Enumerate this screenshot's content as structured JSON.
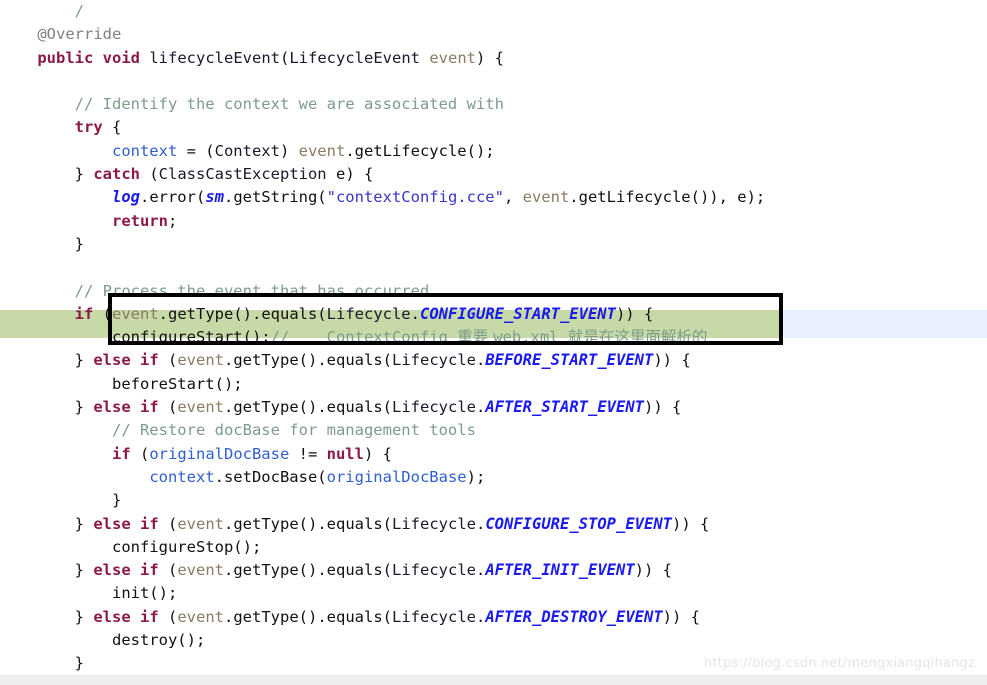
{
  "watermark": {
    "text": "https://blog.csdn.net/mengxiangqihangz"
  },
  "colors": {
    "background": "#ffffff",
    "keyword": "#8b1a4a",
    "comment": "#7d9c8a",
    "annotation": "#808080",
    "string": "#3a34c8",
    "field": "#2f5fd0",
    "static": "#1a1af0",
    "parameter": "#8a7b62",
    "type": "#1a1a2e",
    "plain": "#111111",
    "highlight_green": "#c6d9a6",
    "highlight_blue": "#e8f0fd",
    "annotation_box_border": "#000000",
    "bottom_bar": "#eeeeee",
    "watermark": "#e4e4e4"
  },
  "code": {
    "language": "java",
    "lines": [
      {
        "n": 1,
        "t": "        /"
      },
      {
        "n": 2,
        "t": "    @Override"
      },
      {
        "n": 3,
        "t": "    public void lifecycleEvent(LifecycleEvent event) {"
      },
      {
        "n": 4,
        "t": ""
      },
      {
        "n": 5,
        "t": "        // Identify the context we are associated with"
      },
      {
        "n": 6,
        "t": "        try {"
      },
      {
        "n": 7,
        "t": "            context = (Context) event.getLifecycle();"
      },
      {
        "n": 8,
        "t": "        } catch (ClassCastException e) {"
      },
      {
        "n": 9,
        "t": "            log.error(sm.getString(\"contextConfig.cce\", event.getLifecycle()), e);"
      },
      {
        "n": 10,
        "t": "            return;"
      },
      {
        "n": 11,
        "t": "        }"
      },
      {
        "n": 12,
        "t": ""
      },
      {
        "n": 13,
        "t": "        // Process the event that has occurred"
      },
      {
        "n": 14,
        "t": "        if (event.getType().equals(Lifecycle.CONFIGURE_START_EVENT)) {"
      },
      {
        "n": 15,
        "t": "            configureStart();//    ContextConfig 重要 web.xml 就是在这里面解析的"
      },
      {
        "n": 16,
        "t": "        } else if (event.getType().equals(Lifecycle.BEFORE_START_EVENT)) {"
      },
      {
        "n": 17,
        "t": "            beforeStart();"
      },
      {
        "n": 18,
        "t": "        } else if (event.getType().equals(Lifecycle.AFTER_START_EVENT)) {"
      },
      {
        "n": 19,
        "t": "            // Restore docBase for management tools"
      },
      {
        "n": 20,
        "t": "            if (originalDocBase != null) {"
      },
      {
        "n": 21,
        "t": "                context.setDocBase(originalDocBase);"
      },
      {
        "n": 22,
        "t": "            }"
      },
      {
        "n": 23,
        "t": "        } else if (event.getType().equals(Lifecycle.CONFIGURE_STOP_EVENT)) {"
      },
      {
        "n": 24,
        "t": "            configureStop();"
      },
      {
        "n": 25,
        "t": "        } else if (event.getType().equals(Lifecycle.AFTER_INIT_EVENT)) {"
      },
      {
        "n": 26,
        "t": "            init();"
      },
      {
        "n": 27,
        "t": "        } else if (event.getType().equals(Lifecycle.AFTER_DESTROY_EVENT)) {"
      },
      {
        "n": 28,
        "t": "            destroy();"
      },
      {
        "n": 29,
        "t": "        }"
      }
    ],
    "comments": {
      "identify_context": "// Identify the context we are associated with",
      "process_event": "// Process the event that has occurred",
      "restore_docbase": "// Restore docBase for management tools",
      "highlighted_note": "//    ContextConfig 重要 web.xml 就是在这里面解析的"
    },
    "string_literals": [
      "\"contextConfig.cce\""
    ],
    "static_members": [
      "log",
      "sm",
      "CONFIGURE_START_EVENT",
      "BEFORE_START_EVENT",
      "AFTER_START_EVENT",
      "CONFIGURE_STOP_EVENT",
      "AFTER_INIT_EVENT",
      "AFTER_DESTROY_EVENT"
    ],
    "method_name": "lifecycleEvent",
    "method_calls": [
      "configureStart()",
      "beforeStart()",
      "configureStop()",
      "init()",
      "destroy()"
    ]
  },
  "annotations": {
    "box_label": "annotation-box around configureStart() branch",
    "highlighted_line_text": "configureStart();//    ContextConfig 重要 web.xml 就是在这里面解析的"
  }
}
